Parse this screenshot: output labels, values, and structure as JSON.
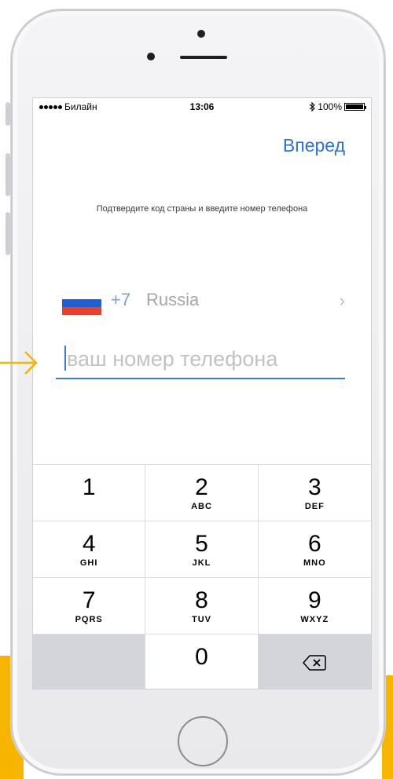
{
  "status_bar": {
    "carrier": "Билайн",
    "time": "13:06",
    "battery": "100%"
  },
  "header": {
    "next_label": "Вперед",
    "accent_color": "#2f6fd8"
  },
  "instruction": "Подтвердите код страны и введите номер телефона",
  "country": {
    "code": "+7",
    "name": "Russia",
    "flag": "russia-flag-icon"
  },
  "phone_field": {
    "value": "",
    "placeholder": "ваш номер телефона"
  },
  "keypad": {
    "keys": [
      {
        "digit": "1",
        "letters": ""
      },
      {
        "digit": "2",
        "letters": "ABC"
      },
      {
        "digit": "3",
        "letters": "DEF"
      },
      {
        "digit": "4",
        "letters": "GHI"
      },
      {
        "digit": "5",
        "letters": "JKL"
      },
      {
        "digit": "6",
        "letters": "MNO"
      },
      {
        "digit": "7",
        "letters": "PQRS"
      },
      {
        "digit": "8",
        "letters": "TUV"
      },
      {
        "digit": "9",
        "letters": "WXYZ"
      },
      {
        "digit": "0",
        "letters": ""
      }
    ],
    "delete_icon": "backspace-icon"
  },
  "annotation": {
    "arrow_color": "#f7b500"
  }
}
